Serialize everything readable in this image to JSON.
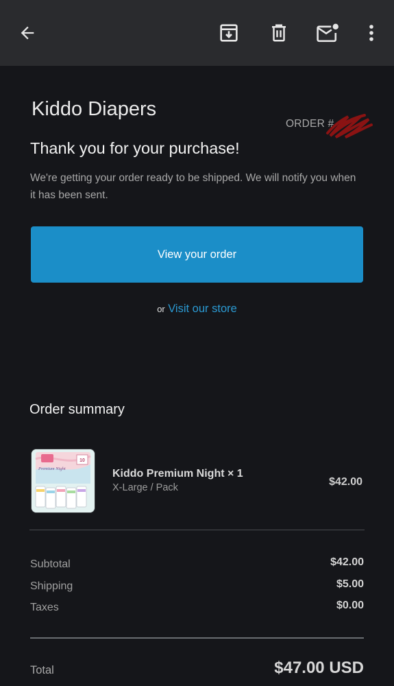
{
  "toolbar": {
    "back_icon": "arrow-left-icon",
    "archive_icon": "archive-icon",
    "delete_icon": "trash-icon",
    "mark_unread_icon": "mail-unread-icon",
    "more_icon": "more-vertical-icon"
  },
  "email": {
    "store_name": "Kiddo Diapers",
    "order_label": "ORDER #",
    "heading": "Thank you for your purchase!",
    "intro": "We're getting your order ready to be shipped. We will notify you when it has been sent.",
    "cta_label": "View your order",
    "or_label": "or",
    "store_link": "Visit our store",
    "summary": {
      "title": "Order summary",
      "item": {
        "name": "Kiddo Premium Night × 1",
        "variant": "X-Large / Pack",
        "price": "$42.00",
        "thumb_text": "Premium Night",
        "thumb_count": "10"
      },
      "lines": [
        {
          "label": "Subtotal",
          "value": "$42.00"
        },
        {
          "label": "Shipping",
          "value": "$5.00"
        },
        {
          "label": "Taxes",
          "value": "$0.00"
        }
      ],
      "total_label": "Total",
      "total_value": "$47.00 USD"
    }
  },
  "colors": {
    "appbar": "#2a2b2e",
    "background": "#15161a",
    "button": "#1b8ec8",
    "link": "#2b9ad3",
    "redaction": "#8a1313"
  }
}
